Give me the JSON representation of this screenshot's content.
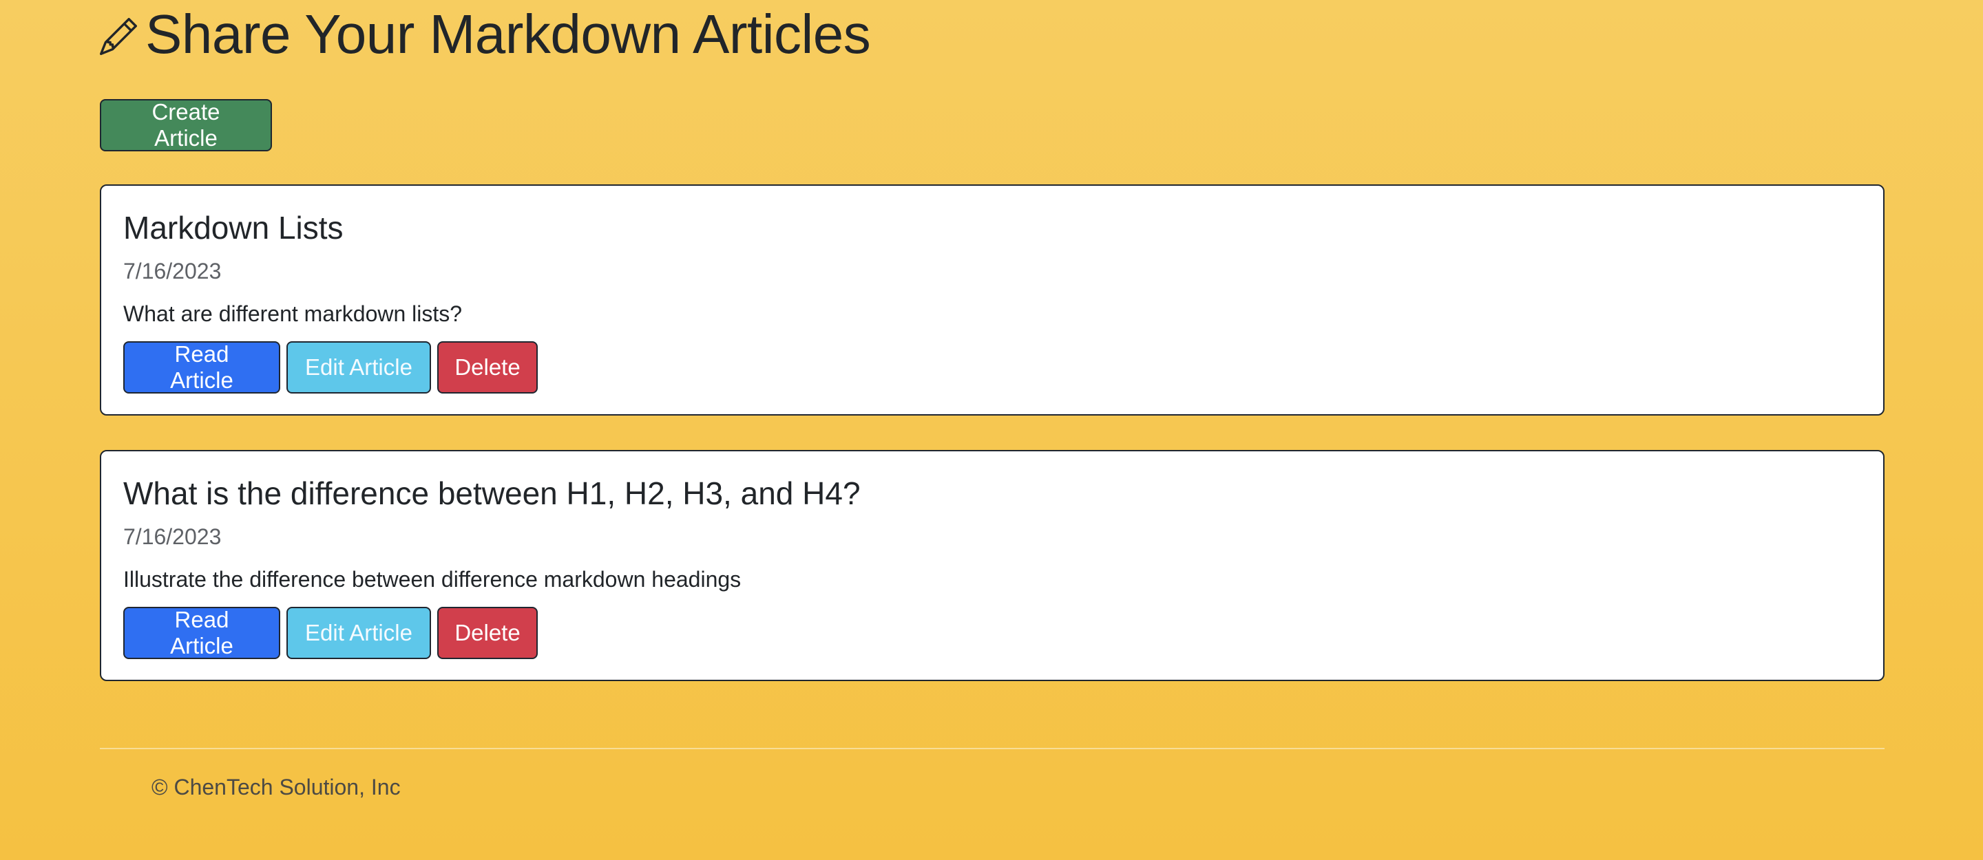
{
  "header": {
    "title": "Share Your Markdown Articles",
    "icon": "pencil-icon"
  },
  "toolbar": {
    "create_label": "Create Article"
  },
  "articles": [
    {
      "title": "Markdown Lists",
      "date": "7/16/2023",
      "description": "What are different markdown lists?",
      "read_label": "Read Article",
      "edit_label": "Edit Article",
      "delete_label": "Delete"
    },
    {
      "title": "What is the difference between H1, H2, H3, and H4?",
      "date": "7/16/2023",
      "description": "Illustrate the difference between difference markdown headings",
      "read_label": "Read Article",
      "edit_label": "Edit Article",
      "delete_label": "Delete"
    }
  ],
  "footer": {
    "text": "© ChenTech Solution, Inc"
  },
  "colors": {
    "background": "#f6c651",
    "create_button": "#44895a",
    "read_button": "#2f6ff2",
    "edit_button": "#5ec7ea",
    "delete_button": "#d13f4c"
  }
}
